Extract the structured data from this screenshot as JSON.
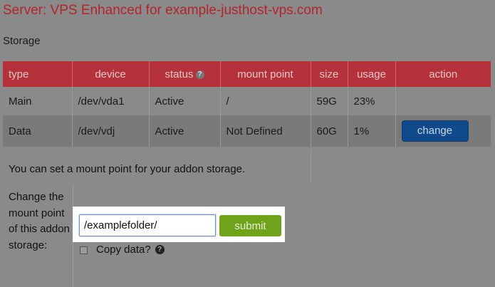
{
  "header": {
    "title": "Server: VPS Enhanced for example-justhost-vps.com"
  },
  "section": {
    "label": "Storage"
  },
  "table": {
    "columns": [
      "type",
      "device",
      "status",
      "mount point",
      "size",
      "usage",
      "action"
    ],
    "help_icon": "question-mark-icon",
    "help_glyph": "?",
    "rows": [
      {
        "type": "Main",
        "device": "/dev/vda1",
        "status": "Active",
        "mount_point": "/",
        "size": "59G",
        "usage": "23%",
        "action": ""
      },
      {
        "type": "Data",
        "device": "/dev/vdj",
        "status": "Active",
        "mount_point": "Not Defined",
        "size": "60G",
        "usage": "1%",
        "action": "change"
      }
    ]
  },
  "mount_info": {
    "text": "You can set a mount point for your addon storage."
  },
  "form": {
    "label": "Change the mount point of this addon storage:",
    "input_value": "/examplefolder/",
    "submit_label": "submit",
    "copy_label": "Copy data?",
    "copy_checked": false
  },
  "colors": {
    "title": "#b5242b",
    "header_bg": "#b6323a",
    "change_button": "#104a8c",
    "submit_button": "#6ea31a"
  }
}
